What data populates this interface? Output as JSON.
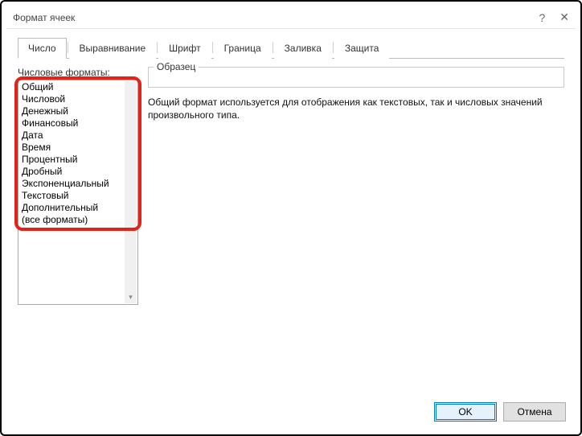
{
  "dialog": {
    "title": "Формат ячеек"
  },
  "tabs": {
    "items": [
      {
        "label": "Число"
      },
      {
        "label": "Выравнивание"
      },
      {
        "label": "Шрифт"
      },
      {
        "label": "Граница"
      },
      {
        "label": "Заливка"
      },
      {
        "label": "Защита"
      }
    ]
  },
  "number_tab": {
    "list_label": "Числовые форматы:",
    "formats": [
      "Общий",
      "Числовой",
      "Денежный",
      "Финансовый",
      "Дата",
      "Время",
      "Процентный",
      "Дробный",
      "Экспоненциальный",
      "Текстовый",
      "Дополнительный",
      "(все форматы)"
    ],
    "sample_label": "Образец",
    "description": "Общий формат используется для отображения как текстовых, так и числовых значений произвольного типа."
  },
  "buttons": {
    "ok": "OK",
    "cancel": "Отмена"
  }
}
